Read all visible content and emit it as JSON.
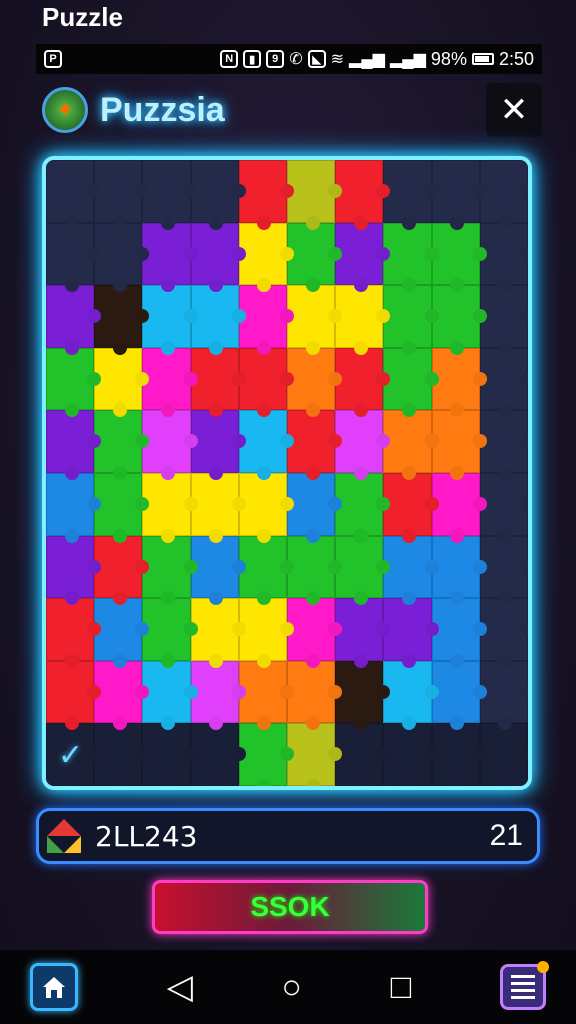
{
  "app_title": "Puzzle",
  "status_bar": {
    "battery": "98%",
    "time": "2:50"
  },
  "header": {
    "app_name": "Puzzsia",
    "close_label": "✕"
  },
  "board": {
    "rows": 10,
    "cols": 10,
    "colors": {
      "navy": "#242a4a",
      "dark": "#1a1f38",
      "purple": "#7a1fd6",
      "blue": "#1e88e5",
      "cyan": "#19b8f0",
      "green": "#22c22a",
      "yellow": "#ffe600",
      "orange": "#ff7a10",
      "red": "#f0202c",
      "magenta": "#ff19c8",
      "pink": "#e040fb",
      "olive": "#b8c21a",
      "brown": "#2a1a12"
    },
    "grid": [
      [
        "navy",
        "navy",
        "navy",
        "navy",
        "red",
        "olive",
        "red",
        "navy",
        "navy",
        "navy"
      ],
      [
        "navy",
        "navy",
        "purple",
        "purple",
        "yellow",
        "green",
        "purple",
        "green",
        "green",
        "navy"
      ],
      [
        "purple",
        "brown",
        "cyan",
        "cyan",
        "magenta",
        "yellow",
        "yellow",
        "green",
        "green",
        "navy"
      ],
      [
        "green",
        "yellow",
        "magenta",
        "red",
        "red",
        "orange",
        "red",
        "green",
        "orange",
        "navy"
      ],
      [
        "purple",
        "green",
        "pink",
        "purple",
        "cyan",
        "red",
        "pink",
        "orange",
        "orange",
        "navy"
      ],
      [
        "blue",
        "green",
        "yellow",
        "yellow",
        "yellow",
        "blue",
        "green",
        "red",
        "magenta",
        "navy"
      ],
      [
        "purple",
        "red",
        "green",
        "blue",
        "green",
        "green",
        "green",
        "blue",
        "blue",
        "navy"
      ],
      [
        "red",
        "blue",
        "green",
        "yellow",
        "yellow",
        "magenta",
        "purple",
        "purple",
        "blue",
        "navy"
      ],
      [
        "red",
        "magenta",
        "cyan",
        "pink",
        "orange",
        "orange",
        "brown",
        "cyan",
        "blue",
        "navy"
      ],
      [
        "dark",
        "dark",
        "dark",
        "dark",
        "green",
        "olive",
        "dark",
        "dark",
        "dark",
        "dark"
      ]
    ]
  },
  "check_mark": "✓",
  "score": {
    "value": "2LL243",
    "moves": "21"
  },
  "ok_button": {
    "label": "SSOK"
  },
  "nav": {
    "back_icon": "◁",
    "home_icon": "○",
    "recents_icon": "□"
  }
}
